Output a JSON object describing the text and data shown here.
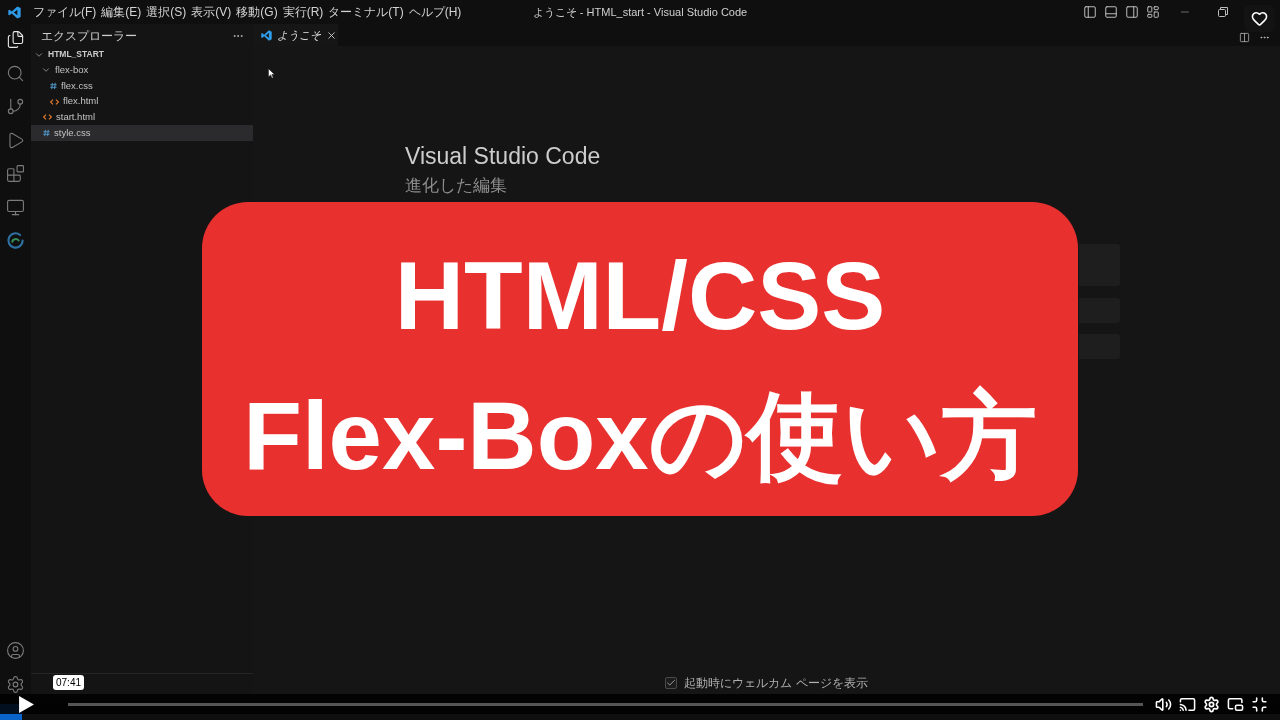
{
  "title_bar": {
    "menus": [
      "ファイル(F)",
      "編集(E)",
      "選択(S)",
      "表示(V)",
      "移動(G)",
      "実行(R)",
      "ターミナル(T)",
      "ヘルプ(H)"
    ],
    "title": "ようこそ - HTML_start - Visual Studio Code"
  },
  "activity_bar": {
    "items": [
      {
        "kind": "explorer",
        "selected": true
      },
      {
        "kind": "search",
        "selected": false
      },
      {
        "kind": "source_control",
        "selected": false
      },
      {
        "kind": "run",
        "selected": false
      },
      {
        "kind": "extensions",
        "selected": false
      },
      {
        "kind": "remote",
        "selected": false
      },
      {
        "kind": "browser",
        "selected": false
      }
    ],
    "bottom_items": [
      {
        "kind": "account"
      },
      {
        "kind": "settings"
      }
    ]
  },
  "sidebar": {
    "title": "エクスプローラー",
    "tree": [
      {
        "label": "HTML_START",
        "kind": "root",
        "expanded": true,
        "selected": false,
        "children": [
          {
            "label": "flex-box",
            "kind": "folder",
            "expanded": true,
            "selected": false,
            "children": [
              {
                "label": "flex.css",
                "kind": "css",
                "selected": false
              },
              {
                "label": "flex.html",
                "kind": "html",
                "selected": false
              }
            ]
          },
          {
            "label": "start.html",
            "kind": "html",
            "selected": false
          },
          {
            "label": "style.css",
            "kind": "css",
            "selected": true
          }
        ]
      }
    ]
  },
  "editor": {
    "tabs": [
      {
        "label": "ようこそ",
        "selected": true
      }
    ],
    "welcome": {
      "title": "Visual Studio Code",
      "subtitle": "進化した編集",
      "tutorial_cards": [
        {
          "kind": "featured"
        },
        {
          "kind": "plain"
        },
        {
          "kind": "plain"
        }
      ],
      "startup_option": {
        "label": "起動時にウェルカム ページを表示",
        "checked": true
      }
    }
  },
  "overlay": {
    "lines": [
      "HTML/CSS",
      "Flex-Boxの使い方"
    ]
  },
  "player": {
    "playing": false,
    "time_tooltip": "07:41"
  }
}
